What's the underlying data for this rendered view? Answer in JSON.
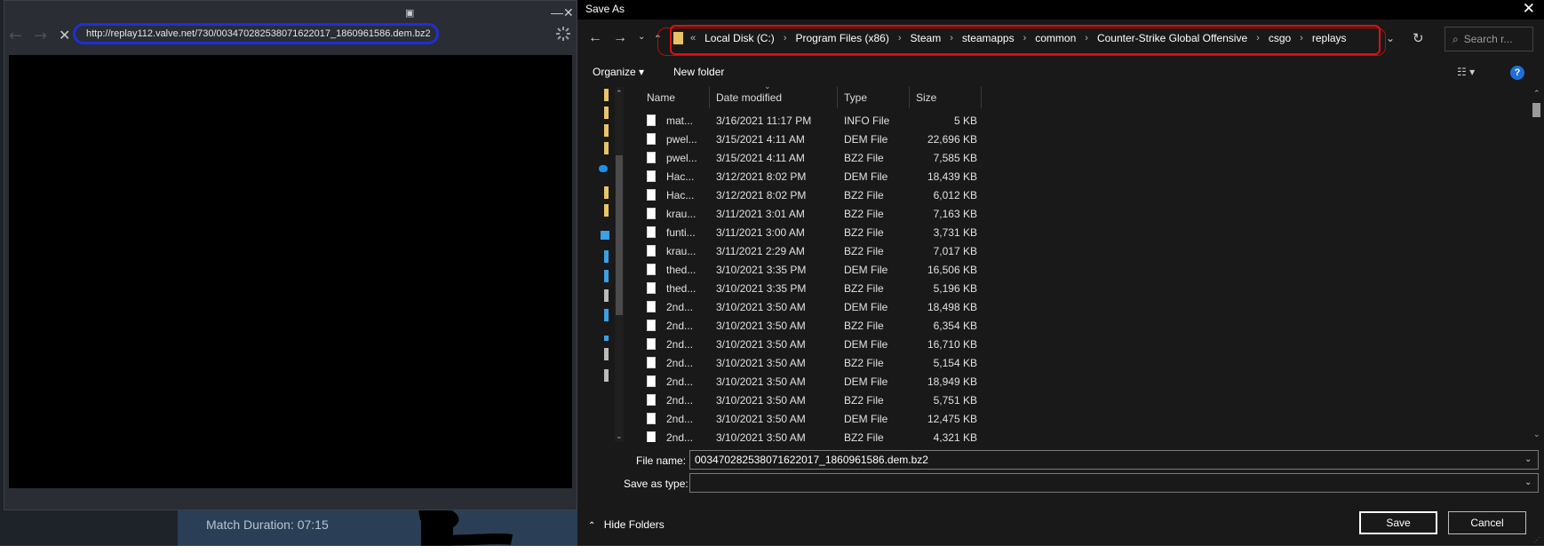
{
  "steam": {
    "match_duration": "Match Duration: 07:15"
  },
  "browser": {
    "url": "http://replay112.valve.net/730/003470282538071622017_1860961586.dem.bz2",
    "back_icon": "←",
    "forward_icon": "→",
    "stop_icon": "✕",
    "minimize_icon": "—",
    "close_icon": "✕"
  },
  "dialog": {
    "title": "Save As",
    "close_icon": "✕",
    "breadcrumb_prefix": "«",
    "breadcrumbs": [
      "Local Disk (C:)",
      "Program Files (x86)",
      "Steam",
      "steamapps",
      "common",
      "Counter-Strike Global Offensive",
      "csgo",
      "replays"
    ],
    "search_placeholder": "Search r...",
    "toolbar": {
      "organize": "Organize ▾",
      "new_folder": "New folder",
      "help": "?"
    },
    "columns": {
      "name": "Name",
      "date": "Date modified",
      "type": "Type",
      "size": "Size"
    },
    "files": [
      {
        "name": "mat...",
        "date": "3/16/2021 11:17 PM",
        "type": "INFO File",
        "size": "5 KB"
      },
      {
        "name": "pwel...",
        "date": "3/15/2021 4:11 AM",
        "type": "DEM File",
        "size": "22,696 KB"
      },
      {
        "name": "pwel...",
        "date": "3/15/2021 4:11 AM",
        "type": "BZ2 File",
        "size": "7,585 KB"
      },
      {
        "name": "Hac...",
        "date": "3/12/2021 8:02 PM",
        "type": "DEM File",
        "size": "18,439 KB"
      },
      {
        "name": "Hac...",
        "date": "3/12/2021 8:02 PM",
        "type": "BZ2 File",
        "size": "6,012 KB"
      },
      {
        "name": "krau...",
        "date": "3/11/2021 3:01 AM",
        "type": "BZ2 File",
        "size": "7,163 KB"
      },
      {
        "name": "funti...",
        "date": "3/11/2021 3:00 AM",
        "type": "BZ2 File",
        "size": "3,731 KB"
      },
      {
        "name": "krau...",
        "date": "3/11/2021 2:29 AM",
        "type": "BZ2 File",
        "size": "7,017 KB"
      },
      {
        "name": "thed...",
        "date": "3/10/2021 3:35 PM",
        "type": "DEM File",
        "size": "16,506 KB"
      },
      {
        "name": "thed...",
        "date": "3/10/2021 3:35 PM",
        "type": "BZ2 File",
        "size": "5,196 KB"
      },
      {
        "name": "2nd...",
        "date": "3/10/2021 3:50 AM",
        "type": "DEM File",
        "size": "18,498 KB"
      },
      {
        "name": "2nd...",
        "date": "3/10/2021 3:50 AM",
        "type": "BZ2 File",
        "size": "6,354 KB"
      },
      {
        "name": "2nd...",
        "date": "3/10/2021 3:50 AM",
        "type": "DEM File",
        "size": "16,710 KB"
      },
      {
        "name": "2nd...",
        "date": "3/10/2021 3:50 AM",
        "type": "BZ2 File",
        "size": "5,154 KB"
      },
      {
        "name": "2nd...",
        "date": "3/10/2021 3:50 AM",
        "type": "DEM File",
        "size": "18,949 KB"
      },
      {
        "name": "2nd...",
        "date": "3/10/2021 3:50 AM",
        "type": "BZ2 File",
        "size": "5,751 KB"
      },
      {
        "name": "2nd...",
        "date": "3/10/2021 3:50 AM",
        "type": "DEM File",
        "size": "12,475 KB"
      },
      {
        "name": "2nd...",
        "date": "3/10/2021 3:50 AM",
        "type": "BZ2 File",
        "size": "4,321 KB"
      }
    ],
    "file_name_label": "File name:",
    "file_name_value": "003470282538071622017_1860961586.dem.bz2",
    "save_as_type_label": "Save as type:",
    "save_as_type_value": "",
    "hide_folders": "Hide Folders",
    "save_label": "Save",
    "cancel_label": "Cancel"
  },
  "colors": {
    "url_highlight": "#1f2fd6",
    "address_highlight": "#e00f0f",
    "folder": "#e8c465"
  }
}
